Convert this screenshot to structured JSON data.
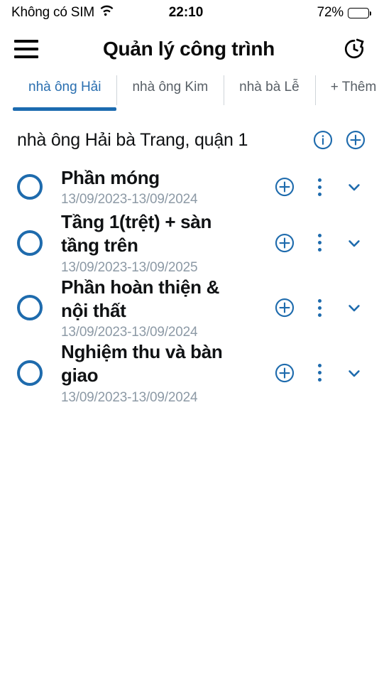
{
  "colors": {
    "accent": "#1e6bad",
    "tab_active": "#2a6fb0",
    "tab_inactive": "#585f66",
    "title": "#101214",
    "date": "#8d9aa6",
    "background": "#ffffff"
  },
  "status_bar": {
    "carrier": "Không có SIM",
    "wifi_icon": "wifi-icon",
    "time": "22:10",
    "battery_percent": "72%",
    "battery_level": 72,
    "battery_icon": "battery-icon"
  },
  "app_bar": {
    "menu_icon": "hamburger-menu-icon",
    "title": "Quản lý công trình",
    "history_icon": "history-restore-icon"
  },
  "tabs": [
    {
      "label": "nhà ông Hải",
      "active": true
    },
    {
      "label": "nhà ông Kim",
      "active": false
    },
    {
      "label": "nhà bà Lễ",
      "active": false
    },
    {
      "label": "+ Thêm công trình",
      "active": false
    }
  ],
  "project_header": {
    "name": "nhà ông Hải bà Trang, quận 1",
    "info_icon": "info-circle-icon",
    "add_icon": "add-circle-icon"
  },
  "task_list": {
    "add_icon": "add-circle-icon",
    "more_icon": "more-vertical-icon",
    "expand_icon": "chevron-down-icon",
    "checkbox_icon": "circle-unchecked-icon",
    "items": [
      {
        "title": "Phần móng",
        "date": "13/09/2023-13/09/2024",
        "checked": false
      },
      {
        "title": "Tầng 1(trệt) + sàn tầng trên",
        "date": "13/09/2023-13/09/2025",
        "checked": false
      },
      {
        "title": "Phần hoàn thiện & nội thất",
        "date": "13/09/2023-13/09/2024",
        "checked": false
      },
      {
        "title": "Nghiệm thu và bàn giao",
        "date": "13/09/2023-13/09/2024",
        "checked": false
      }
    ]
  }
}
